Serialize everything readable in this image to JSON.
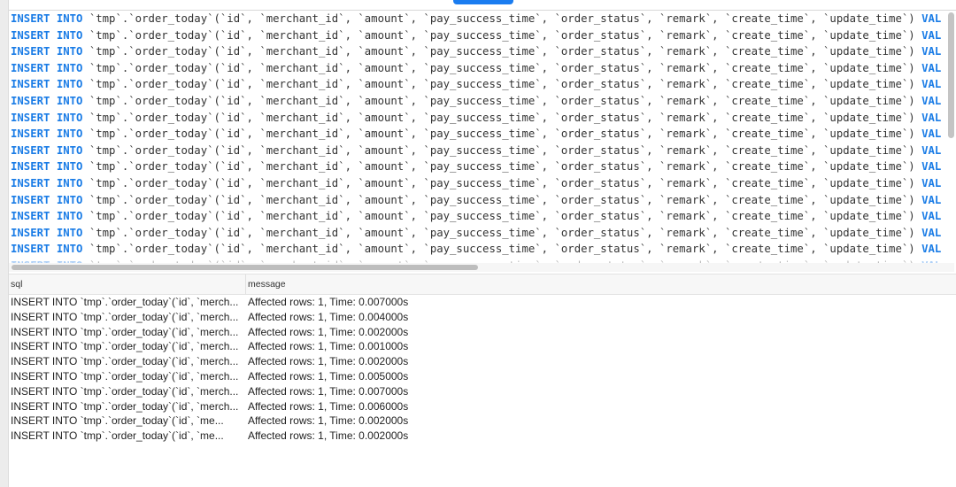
{
  "editor": {
    "keyword": "INSERT INTO",
    "rest": " `tmp`.`order_today`(`id`, `merchant_id`, `amount`, `pay_success_time`, `order_status`, `remark`, `create_time`, `update_time`) ",
    "tail_keyword": "VAL",
    "line_count": 16
  },
  "results": {
    "columns": [
      "sql",
      "message"
    ],
    "rows": [
      {
        "sql": "INSERT INTO `tmp`.`order_today`(`id`, `merch...",
        "message": "Affected rows: 1, Time: 0.007000s"
      },
      {
        "sql": "INSERT INTO `tmp`.`order_today`(`id`, `merch...",
        "message": "Affected rows: 1, Time: 0.004000s"
      },
      {
        "sql": "INSERT INTO `tmp`.`order_today`(`id`, `merch...",
        "message": "Affected rows: 1, Time: 0.002000s"
      },
      {
        "sql": "INSERT INTO `tmp`.`order_today`(`id`, `merch...",
        "message": "Affected rows: 1, Time: 0.001000s"
      },
      {
        "sql": "INSERT INTO `tmp`.`order_today`(`id`, `merch...",
        "message": "Affected rows: 1, Time: 0.002000s"
      },
      {
        "sql": "INSERT INTO `tmp`.`order_today`(`id`, `merch...",
        "message": "Affected rows: 1, Time: 0.005000s"
      },
      {
        "sql": "INSERT INTO `tmp`.`order_today`(`id`, `merch...",
        "message": "Affected rows: 1, Time: 0.007000s"
      },
      {
        "sql": "INSERT INTO `tmp`.`order_today`(`id`, `merch...",
        "message": "Affected rows: 1, Time: 0.006000s"
      },
      {
        "sql": "INSERT INTO `tmp`.`order_today`(`id`, `me...",
        "message": "Affected rows: 1, Time: 0.002000s"
      },
      {
        "sql": "INSERT INTO `tmp`.`order_today`(`id`, `me...",
        "message": "Affected rows: 1, Time: 0.002000s"
      }
    ]
  },
  "colors": {
    "keyword": "#1a7ce6",
    "button": "#1a7cf0"
  }
}
